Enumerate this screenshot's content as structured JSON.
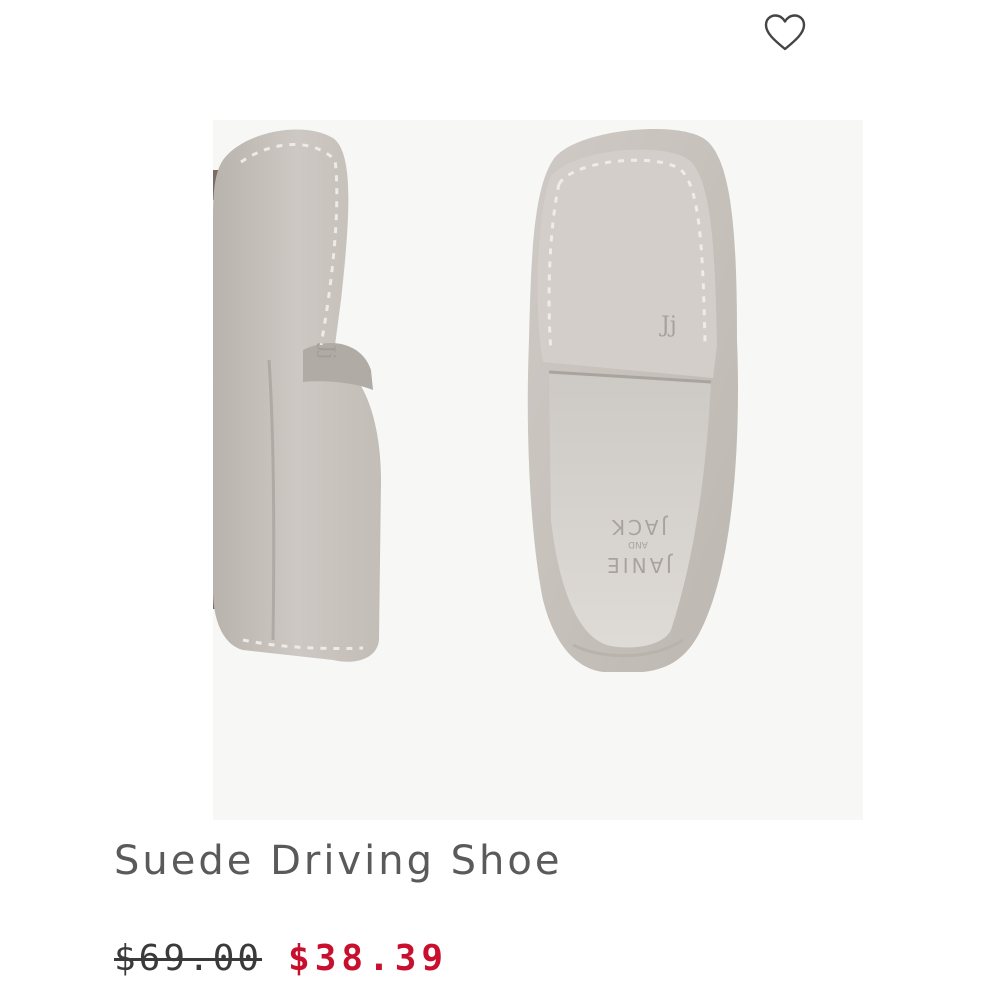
{
  "product": {
    "name": "Suede Driving Shoe",
    "original_price": "$69.00",
    "sale_price": "$38.39",
    "image_alt": "Suede Driving Shoe",
    "insole_brand": [
      "JANIE",
      "AND",
      "JACK"
    ],
    "monogram": "JJ"
  },
  "icons": {
    "wishlist": "heart-outline-icon"
  },
  "colors": {
    "sale_price": "#c8102e",
    "original_price": "#3a3a3a",
    "name": "#5a5a5a",
    "suede": "#c9c4bf"
  }
}
